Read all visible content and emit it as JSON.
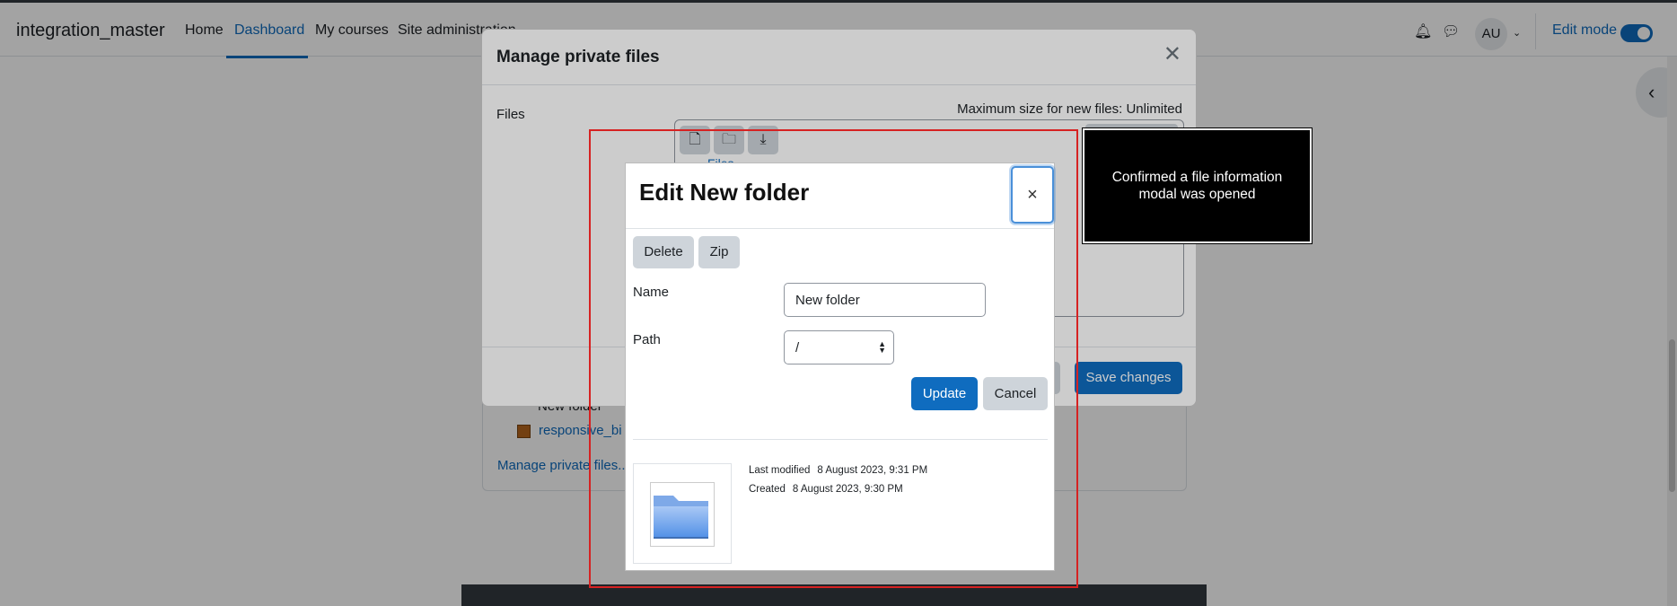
{
  "navbar": {
    "brand": "integration_master",
    "links": [
      "Home",
      "Dashboard",
      "My courses",
      "Site administration"
    ],
    "avatar_initials": "AU",
    "edit_mode_label": "Edit mode",
    "edit_mode_on": true
  },
  "background": {
    "tree_folder": "New folder",
    "tree_file": "responsive_bi",
    "manage_link": "Manage private files..."
  },
  "manage_modal": {
    "title": "Manage private files",
    "files_label": "Files",
    "max_size": "Maximum size for new files: Unlimited",
    "breadcrumb": "Files",
    "save_label": "Save changes"
  },
  "edit_dialog": {
    "title": "Edit New folder",
    "close_glyph": "×",
    "delete_label": "Delete",
    "zip_label": "Zip",
    "name_label": "Name",
    "name_value": "New folder",
    "path_label": "Path",
    "path_value": "/",
    "update_label": "Update",
    "cancel_label": "Cancel",
    "last_modified_label": "Last modified",
    "last_modified_value": "8 August 2023, 9:31 PM",
    "created_label": "Created",
    "created_value": "8 August 2023, 9:30 PM"
  },
  "tooltip": {
    "text": "Confirmed a file information modal was opened"
  },
  "colors": {
    "primary": "#0f6cbf",
    "secondary": "#ced4da",
    "annotation": "#d62222"
  }
}
